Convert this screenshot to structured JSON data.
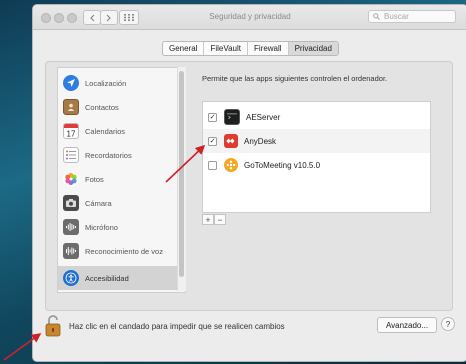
{
  "window": {
    "title": "Seguridad y privacidad"
  },
  "search": {
    "placeholder": "Buscar"
  },
  "tabs": [
    {
      "label": "General",
      "active": false
    },
    {
      "label": "FileVault",
      "active": false
    },
    {
      "label": "Firewall",
      "active": false
    },
    {
      "label": "Privacidad",
      "active": true
    }
  ],
  "sidebar": {
    "items": [
      {
        "label": "Localización",
        "icon": "location-arrow-icon"
      },
      {
        "label": "Contactos",
        "icon": "contacts-book-icon"
      },
      {
        "label": "Calendarios",
        "icon": "calendar-icon"
      },
      {
        "label": "Recordatorios",
        "icon": "reminders-list-icon"
      },
      {
        "label": "Fotos",
        "icon": "photos-flower-icon"
      },
      {
        "label": "Cámara",
        "icon": "camera-icon"
      },
      {
        "label": "Micrófono",
        "icon": "microphone-waveform-icon"
      },
      {
        "label": "Reconocimiento de voz",
        "icon": "speech-waveform-icon"
      },
      {
        "label": "Accesibilidad",
        "icon": "accessibility-icon",
        "selected": true
      }
    ]
  },
  "main": {
    "prompt": "Permite que las apps siguientes controlen el ordenador.",
    "apps": [
      {
        "name": "AEServer",
        "checked": true,
        "icon": "terminal-app-icon"
      },
      {
        "name": "AnyDesk",
        "checked": true,
        "icon": "anydesk-app-icon"
      },
      {
        "name": "GoToMeeting v10.5.0",
        "checked": false,
        "icon": "gotomeeting-app-icon"
      }
    ],
    "add_label": "+",
    "remove_label": "−"
  },
  "footer": {
    "lock_text": "Haz clic en el candado para impedir que se realicen cambios",
    "advanced_label": "Avanzado...",
    "help_label": "?"
  },
  "annotation": {
    "arrow_color": "#d1202a"
  },
  "checkmark": "✓"
}
